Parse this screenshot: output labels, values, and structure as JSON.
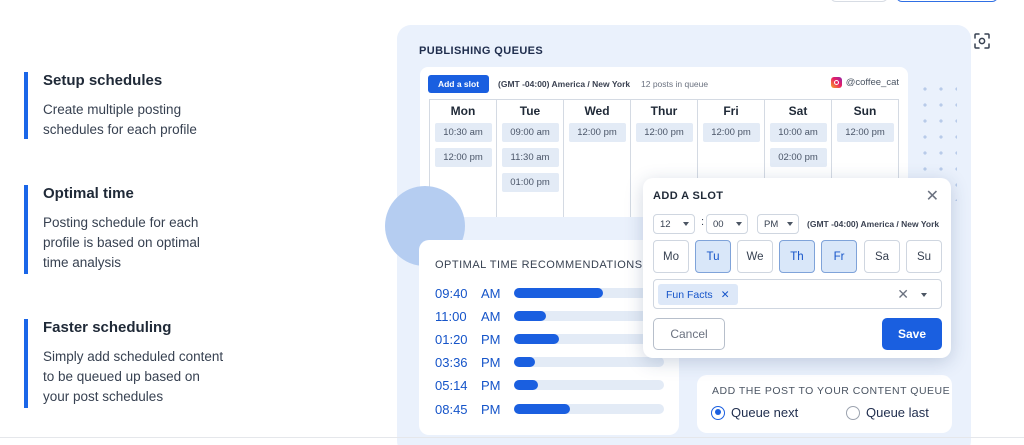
{
  "features": [
    {
      "title": "Setup schedules",
      "desc_lines": [
        "Create multiple posting",
        "schedules for each profile"
      ]
    },
    {
      "title": "Optimal time",
      "desc_lines": [
        "Posting schedule for each",
        "profile is based on optimal",
        "time analysis"
      ]
    },
    {
      "title": "Faster scheduling",
      "desc_lines": [
        "Simply add scheduled content",
        "to be queued up based on",
        "your post schedules"
      ]
    }
  ],
  "publishing": {
    "title": "PUBLISHING QUEUES",
    "add_slot_label": "Add a slot",
    "timezone": "(GMT -04:00) America / New York",
    "posts_in_queue": "12 posts in queue",
    "profile": "@coffee_cat",
    "days": [
      {
        "name": "Mon",
        "slots": [
          "10:30 am",
          "12:00 pm"
        ]
      },
      {
        "name": "Tue",
        "slots": [
          "09:00 am",
          "11:30 am",
          "01:00 pm"
        ]
      },
      {
        "name": "Wed",
        "slots": [
          "12:00 pm"
        ]
      },
      {
        "name": "Thur",
        "slots": [
          "12:00 pm"
        ]
      },
      {
        "name": "Fri",
        "slots": [
          "12:00 pm"
        ]
      },
      {
        "name": "Sat",
        "slots": [
          "10:00 am",
          "02:00 pm"
        ]
      },
      {
        "name": "Sun",
        "slots": [
          "12:00 pm"
        ]
      }
    ]
  },
  "optimal": {
    "title": "OPTIMAL TIME RECOMMENDATIONS",
    "rows": [
      {
        "time": "09:40",
        "ampm": "AM",
        "level": 0.59
      },
      {
        "time": "11:00",
        "ampm": "AM",
        "level": 0.21
      },
      {
        "time": "01:20",
        "ampm": "PM",
        "level": 0.3
      },
      {
        "time": "03:36",
        "ampm": "PM",
        "level": 0.14
      },
      {
        "time": "05:14",
        "ampm": "PM",
        "level": 0.16
      },
      {
        "time": "08:45",
        "ampm": "PM",
        "level": 0.37
      }
    ]
  },
  "queue": {
    "title": "ADD THE POST TO YOUR CONTENT QUEUE",
    "option_next": "Queue next",
    "option_last": "Queue last",
    "selected": "Queue next"
  },
  "modal": {
    "title": "ADD A SLOT",
    "close_icon": "close-icon",
    "hour": "12",
    "minute": "00",
    "ampm": "PM",
    "colon": ":",
    "timezone": "(GMT -04:00) America / New York",
    "days": [
      {
        "label": "Mo",
        "active": false
      },
      {
        "label": "Tu",
        "active": true
      },
      {
        "label": "We",
        "active": false
      },
      {
        "label": "Th",
        "active": true
      },
      {
        "label": "Fr",
        "active": true
      },
      {
        "label": "Sa",
        "active": false
      },
      {
        "label": "Su",
        "active": false
      }
    ],
    "tag": "Fun Facts",
    "cancel_label": "Cancel",
    "save_label": "Save"
  },
  "colors": {
    "accent": "#1a5fe0",
    "panel_bg": "#eaf1fc",
    "slot_bg": "#e3ebf6"
  }
}
